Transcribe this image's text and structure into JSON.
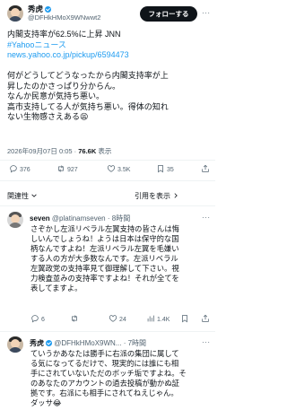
{
  "post": {
    "author_name": "秀虎",
    "author_handle": "@DFHkHMoX9WNwwt2",
    "follow_label": "フォローする",
    "more_label": "···",
    "lines": [
      "内閣支持率が62.5%に上昇 JNN",
      "#Yahooニュース",
      "news.yahoo.co.jp/pickup/6594473",
      "",
      "何がどうしてどうなったから内閣支持率が上",
      "昇したのかさっぱり分からん。",
      "なんか民意が気持ち悪い。",
      "高市支持してる人が気持ち悪い。得体の知れ",
      "ない生物感さえある😫"
    ],
    "timestamp": "2026年09月07日 0:05",
    "views": "76.6K",
    "views_label": "表示",
    "actions": {
      "replies": "376",
      "reposts": "927",
      "likes": "3.5K",
      "bookmarks": "35"
    }
  },
  "related": {
    "left_label": "関連性",
    "right_label": "引用を表示"
  },
  "replies": [
    {
      "author_name": "seven",
      "author_handle": "@platinamseven",
      "time": "· 8時間",
      "lines": [
        "さぞかし左派リベラル左翼支持の皆さんは悔",
        "しいんでしょうね！ようは日本は保守的な国",
        "柄なんですよね！左派リベラル左翼を毛嫌い",
        "する人の方が大多数なんです。左派リベラル",
        "左翼政党の支持率見て御理解して下さい。視",
        "力検査並みの支持率ですよね！それが全てを",
        "表してますよ。"
      ],
      "actions": {
        "replies": "6",
        "reposts": "",
        "likes": "24",
        "views": "1.4K"
      }
    },
    {
      "author_name": "秀虎",
      "author_handle": "@DFHkHMoX9WN...",
      "time": "· 7時間",
      "lines": [
        "ていうかあなたは勝手に右派の集団に属して",
        "る気になってるだけで、現実的には誰にも相",
        "手にされていないただのボッチ垢ですよね。そ",
        "のあなたのアカウントの過去投稿が動かぬ証",
        "拠です。右派にも相手にされてねえじゃん。",
        "ダッサ😂"
      ]
    }
  ],
  "colors": {
    "accent": "#1d9bf0",
    "text": "#0f1419",
    "muted": "#536471"
  }
}
